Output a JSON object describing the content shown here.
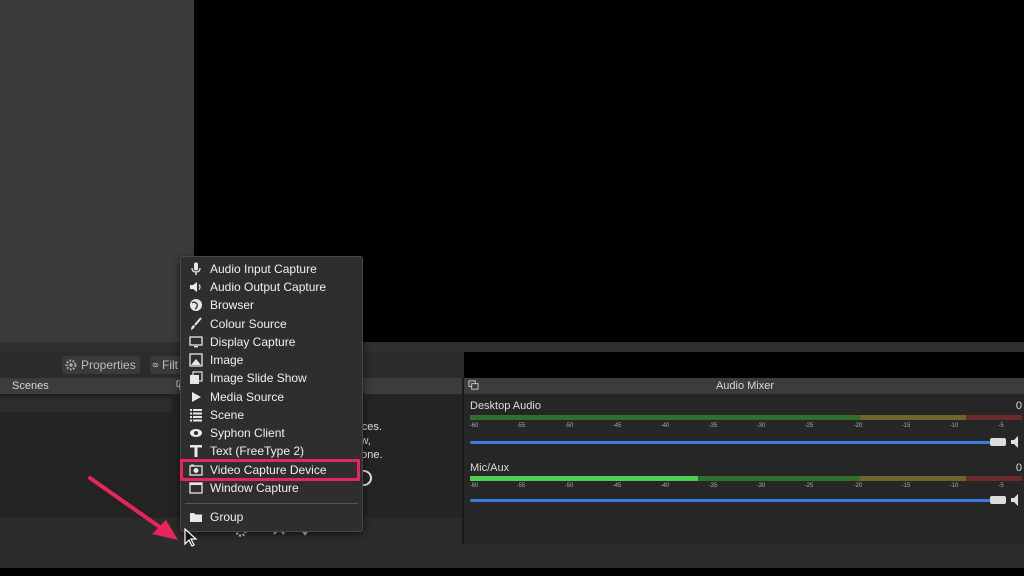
{
  "toolbar": {
    "properties_label": "Properties",
    "filters_label": "Filt"
  },
  "scenes": {
    "title": "Scenes"
  },
  "sources": {
    "hint_lines": [
      "urces.",
      "low,",
      "d one."
    ]
  },
  "mixer": {
    "title": "Audio Mixer",
    "ticks": [
      "-60",
      "-55",
      "-50",
      "-45",
      "-40",
      "-35",
      "-30",
      "-25",
      "-20",
      "-15",
      "-10",
      "-5",
      "0"
    ],
    "channels": [
      {
        "name": "Desktop Audio",
        "db": "0"
      },
      {
        "name": "Mic/Aux",
        "db": "0"
      }
    ]
  },
  "menu": {
    "items": [
      {
        "label": "Audio Input Capture",
        "icon": "microphone-icon"
      },
      {
        "label": "Audio Output Capture",
        "icon": "speaker-icon"
      },
      {
        "label": "Browser",
        "icon": "globe-icon"
      },
      {
        "label": "Colour Source",
        "icon": "brush-icon"
      },
      {
        "label": "Display Capture",
        "icon": "monitor-icon"
      },
      {
        "label": "Image",
        "icon": "image-icon"
      },
      {
        "label": "Image Slide Show",
        "icon": "slideshow-icon"
      },
      {
        "label": "Media Source",
        "icon": "play-icon"
      },
      {
        "label": "Scene",
        "icon": "list-icon"
      },
      {
        "label": "Syphon Client",
        "icon": "syphon-icon"
      },
      {
        "label": "Text (FreeType 2)",
        "icon": "text-icon"
      },
      {
        "label": "Video Capture Device",
        "icon": "camera-icon"
      },
      {
        "label": "Window Capture",
        "icon": "window-icon"
      },
      {
        "label": "Group",
        "icon": "folder-icon"
      }
    ],
    "highlighted": "Video Capture Device"
  },
  "colors": {
    "highlight": "#e8245a",
    "meter_green": "#3fae3f",
    "meter_yellow": "#b5a23a",
    "meter_red": "#b03a3a",
    "fader_blue": "#3b7bdc"
  }
}
